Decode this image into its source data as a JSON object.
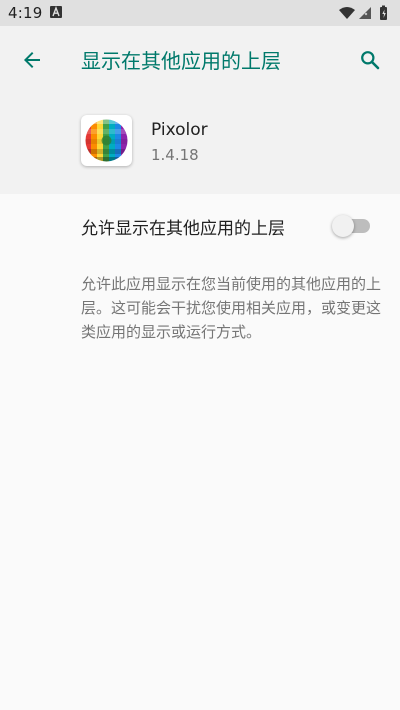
{
  "status_bar": {
    "time": "4:19"
  },
  "header": {
    "title": "显示在其他应用的上层",
    "back_icon": "arrow-back-icon",
    "search_icon": "search-icon"
  },
  "app": {
    "name": "Pixolor",
    "version": "1.4.18"
  },
  "setting": {
    "label": "允许显示在其他应用的上层",
    "enabled": false
  },
  "description": "允许此应用显示在您当前使用的其他应用的上层。这可能会干扰您使用相关应用，或变更这类应用的显示或运行方式。",
  "colors": {
    "accent": "#00796b",
    "header_bg": "#f2f2f2",
    "page_bg": "#fafafa",
    "status_bar_bg": "#e0e0e0"
  }
}
